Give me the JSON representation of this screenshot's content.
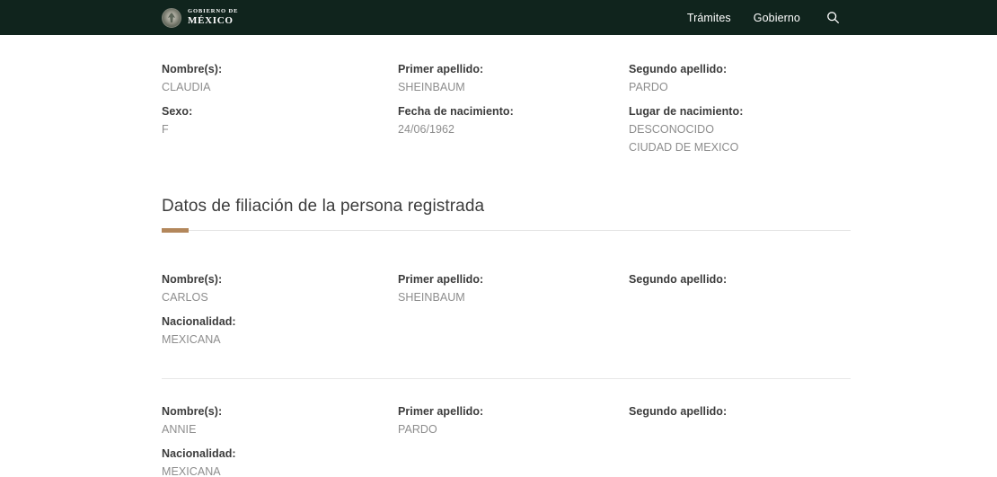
{
  "header": {
    "brand": {
      "line1": "GOBIERNO DE",
      "line2": "MÉXICO",
      "seal_icon": "mexican-eagle-seal-icon"
    },
    "nav": [
      {
        "label": "Trámites"
      },
      {
        "label": "Gobierno"
      }
    ],
    "search_icon": "search-icon",
    "background_color": "#10241d"
  },
  "theme": {
    "accent_color": "#b3875b",
    "label_color": "#3b3b3b",
    "value_color": "#8d8d8d",
    "rule_color": "#e3e3e3"
  },
  "registered_person": {
    "fields": [
      {
        "label": "Nombre(s):",
        "value": "CLAUDIA"
      },
      {
        "label": "Primer apellido:",
        "value": "SHEINBAUM"
      },
      {
        "label": "Segundo apellido:",
        "value": "PARDO"
      },
      {
        "label": "Sexo:",
        "value": "F"
      },
      {
        "label": "Fecha de nacimiento:",
        "value": "24/06/1962"
      },
      {
        "label": "Lugar de nacimiento:",
        "value": "DESCONOCIDO\nCIUDAD DE MEXICO"
      }
    ]
  },
  "filiation_section": {
    "title": "Datos de filiación de la persona registrada",
    "parents": [
      {
        "fields": [
          {
            "label": "Nombre(s):",
            "value": "CARLOS"
          },
          {
            "label": "Primer apellido:",
            "value": "SHEINBAUM"
          },
          {
            "label": "Segundo apellido:",
            "value": ""
          },
          {
            "label": "Nacionalidad:",
            "value": "MEXICANA"
          }
        ]
      },
      {
        "fields": [
          {
            "label": "Nombre(s):",
            "value": "ANNIE"
          },
          {
            "label": "Primer apellido:",
            "value": "PARDO"
          },
          {
            "label": "Segundo apellido:",
            "value": ""
          },
          {
            "label": "Nacionalidad:",
            "value": "MEXICANA"
          }
        ]
      }
    ]
  }
}
